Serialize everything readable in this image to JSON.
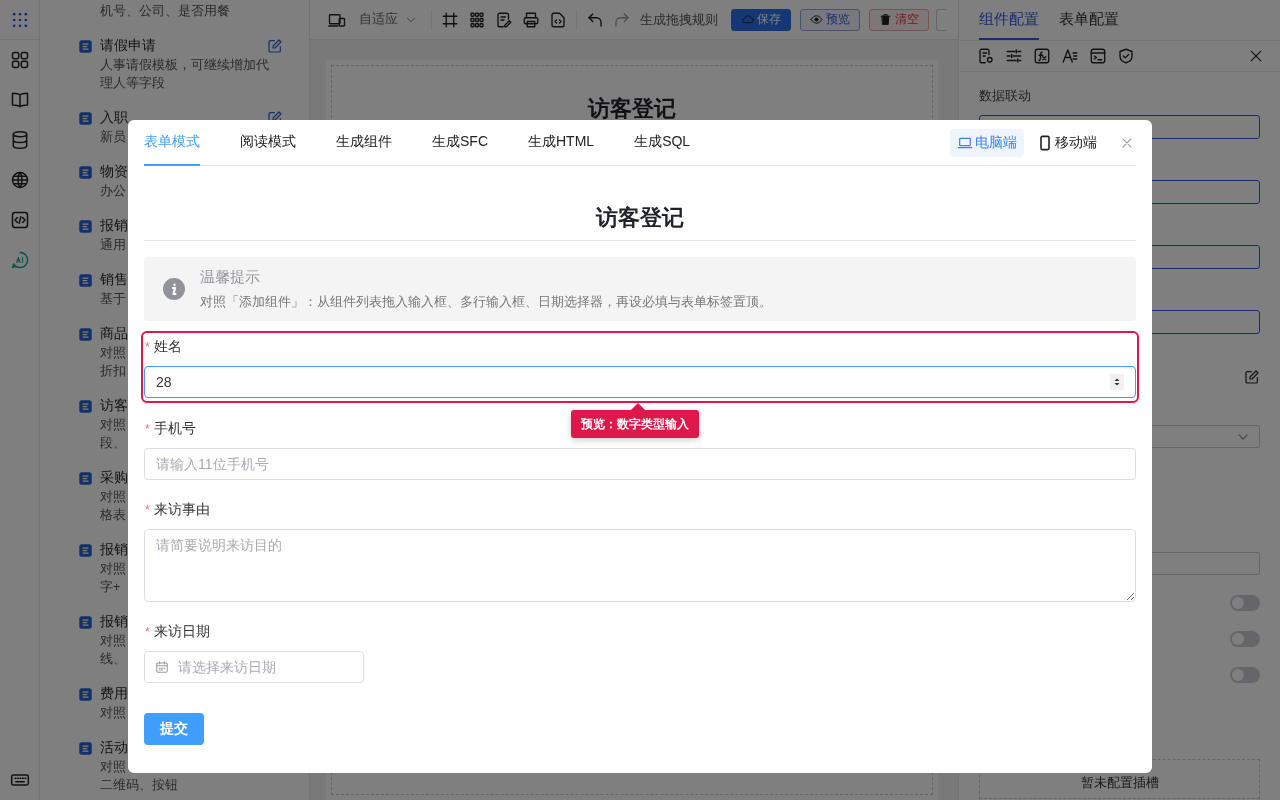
{
  "template_list": {
    "items": [
      {
        "desc_lines": [
          "机号、公司、是否用餐"
        ]
      },
      {
        "title": "请假申请",
        "desc_lines": [
          "人事请假模板，可继续增加代",
          "理人等字段"
        ],
        "editable": true
      },
      {
        "title": "入职",
        "desc_lines": [
          "新员"
        ],
        "editable": true
      },
      {
        "title": "物资",
        "desc_lines": [
          "办公"
        ]
      },
      {
        "title": "报销",
        "desc_lines": [
          "通用"
        ]
      },
      {
        "title": "销售",
        "desc_lines": [
          "基于"
        ]
      },
      {
        "title": "商品",
        "desc_lines": [
          "对照",
          "折扣"
        ]
      },
      {
        "title": "访客",
        "desc_lines": [
          "对照",
          "段、"
        ]
      },
      {
        "title": "采购",
        "desc_lines": [
          "对照",
          "格表"
        ]
      },
      {
        "title": "报销",
        "desc_lines": [
          "对照",
          "字+"
        ]
      },
      {
        "title": "报销",
        "desc_lines": [
          "对照",
          "线、"
        ]
      },
      {
        "title": "费用",
        "desc_lines": [
          "对照"
        ]
      },
      {
        "title": "活动",
        "desc_lines": [
          "对照",
          "二维码、按钮"
        ]
      }
    ]
  },
  "toolbar": {
    "scale": "自适应",
    "rule_label": "生成拖拽规则",
    "buttons": [
      {
        "label": "保存",
        "kind": "primary"
      },
      {
        "label": "预览",
        "kind": "outline"
      },
      {
        "label": "清空",
        "kind": "danger"
      }
    ]
  },
  "canvas": {
    "title": "访客登记"
  },
  "config_panel": {
    "tabs": [
      {
        "label": "组件配置",
        "selected": true
      },
      {
        "label": "表单配置",
        "selected": false
      }
    ],
    "section_label": "数据联动",
    "toggles": [
      {
        "checked": false
      },
      {
        "checked": false
      },
      {
        "checked": false
      }
    ],
    "slot_placeholder": "暂未配置插槽"
  },
  "modal": {
    "tabs": [
      {
        "label": "表单模式",
        "selected": true
      },
      {
        "label": "阅读模式",
        "selected": false
      },
      {
        "label": "生成组件",
        "selected": false
      },
      {
        "label": "生成SFC",
        "selected": false
      },
      {
        "label": "生成HTML",
        "selected": false
      },
      {
        "label": "生成SQL",
        "selected": false
      }
    ],
    "devices": [
      {
        "label": "电脑端",
        "kind": "desktop",
        "selected": true
      },
      {
        "label": "移动端",
        "kind": "mobile",
        "selected": false
      }
    ],
    "title": "访客登记",
    "required_mark": "*",
    "notice": {
      "title": "温馨提示",
      "text": "对照「添加组件」：从组件列表拖入输入框、多行输入框、日期选择器，再设必填与表单标签置顶。"
    },
    "fields": [
      {
        "kind": "number",
        "label": "姓名",
        "required": true,
        "value": "28",
        "highlighted": true,
        "tooltip": "预览：数字类型输入"
      },
      {
        "kind": "text",
        "label": "手机号",
        "required": true,
        "placeholder": "请输入11位手机号",
        "highlighted": false
      },
      {
        "kind": "textarea",
        "label": "来访事由",
        "required": true,
        "placeholder": "请简要说明来访目的",
        "highlighted": false
      },
      {
        "kind": "date",
        "label": "来访日期",
        "required": true,
        "placeholder": "请选择来访日期",
        "highlighted": false
      }
    ],
    "submit": "提交"
  }
}
